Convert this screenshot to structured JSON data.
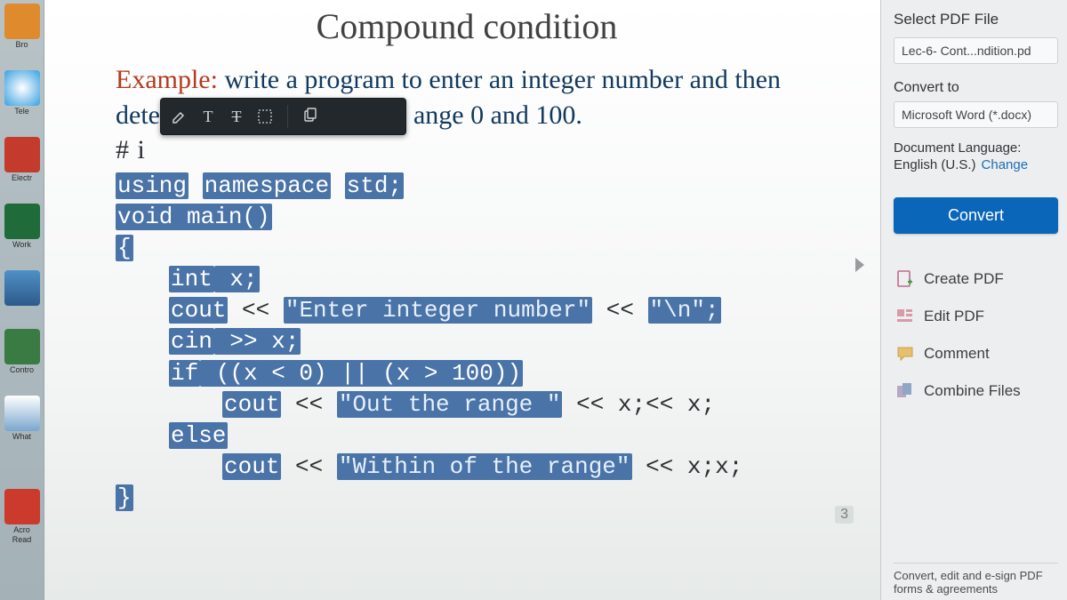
{
  "taskbar": {
    "items": [
      {
        "label": "Bro"
      },
      {
        "label": "Tele"
      },
      {
        "label": "Electr"
      },
      {
        "label": "Work"
      },
      {
        "label": ""
      },
      {
        "label": "Contro"
      },
      {
        "label": "What"
      },
      {
        "label": "Acro"
      },
      {
        "label": "Read"
      }
    ]
  },
  "slide": {
    "title": "Compound condition",
    "example_prefix": "Example:",
    "example_text_l1": " write a program to enter an integer number and then",
    "example_text_l2a": "dete",
    "example_text_l2b": "ange 0 and 100.",
    "hash_line": "# i",
    "page_number": "3",
    "code": {
      "l1a": "using",
      "l1b": " ",
      "l1c": "namespace",
      "l1d": " ",
      "l1e": "std;",
      "l2": "void main()",
      "l3": "{",
      "l4a": "int",
      "l4b": " x;",
      "l5a": "cout",
      "l5b": " << ",
      "l5c": "\"Enter integer number\"",
      "l5d": " << ",
      "l5e": "\"\\n\";",
      "l6a": "cin",
      "l6b": " >> x;",
      "l7a": "if",
      "l7b": " ((x < 0) || (x > 100))",
      "l8a": "cout",
      "l8b": " << ",
      "l8c": "\"Out the range \"",
      "l8d": " << x;",
      "l9": "else",
      "l10a": "cout",
      "l10b": " << ",
      "l10c": "\"Within of the range\"",
      "l10d": " << x;",
      "l11": "}"
    }
  },
  "panel": {
    "select_label": "Select PDF File",
    "file_name": "Lec-6- Cont...ndition.pd",
    "convert_to_label": "Convert to",
    "convert_to_value": "Microsoft Word (*.docx)",
    "doc_lang_label": "Document Language:",
    "doc_lang_value": "English (U.S.)",
    "change_link": "Change",
    "convert_button": "Convert",
    "tools": {
      "create": "Create PDF",
      "edit": "Edit PDF",
      "comment": "Comment",
      "combine": "Combine Files"
    },
    "footer_l1": "Convert, edit and e-sign PDF",
    "footer_l2": "forms & agreements"
  }
}
